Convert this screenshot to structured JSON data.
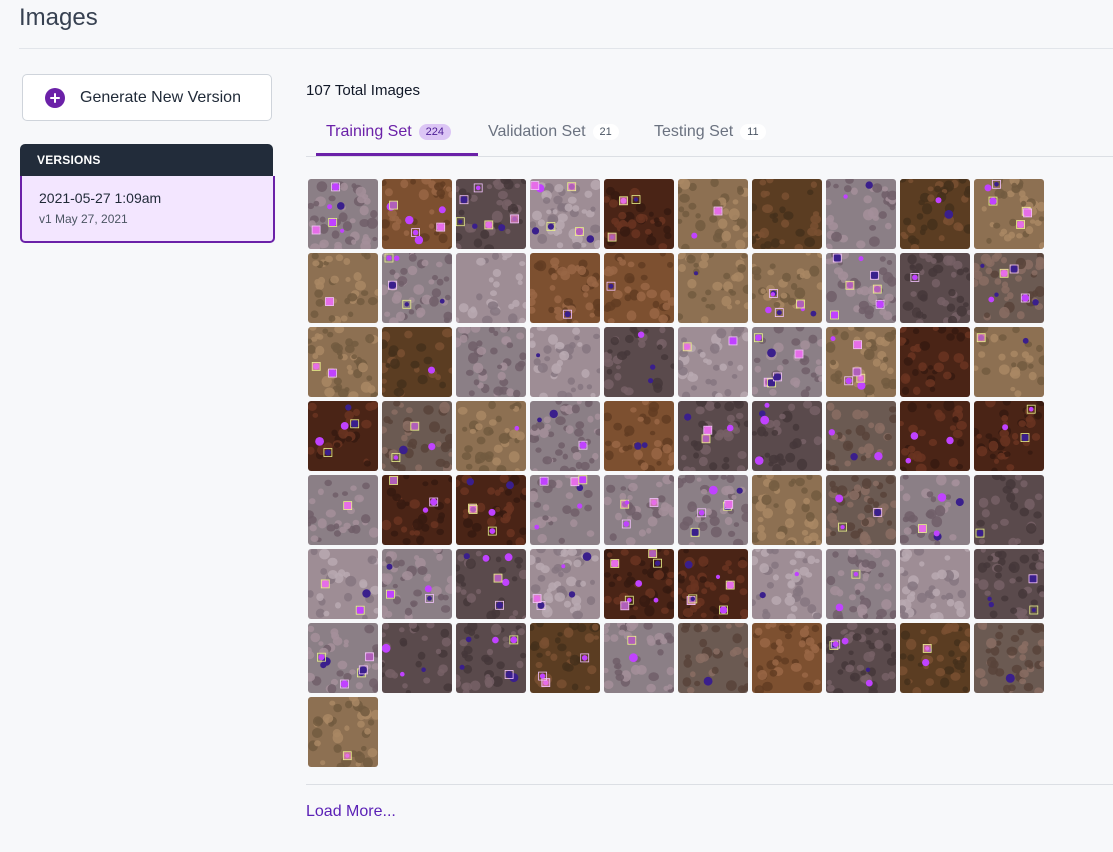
{
  "header": {
    "title": "Images"
  },
  "sidebar": {
    "generate_label": "Generate New Version",
    "versions_heading": "VERSIONS",
    "versions": [
      {
        "name": "2021-05-27 1:09am",
        "subtitle": "v1 May 27, 2021"
      }
    ]
  },
  "main": {
    "total_label": "107 Total Images",
    "tabs": [
      {
        "label": "Training Set",
        "count": "224"
      },
      {
        "label": "Validation Set",
        "count": "21"
      },
      {
        "label": "Testing Set",
        "count": "11"
      }
    ],
    "load_more_label": "Load More...",
    "thumbnail_count": 71
  },
  "colors": {
    "accent": "#6b21a8",
    "tab_badge_bg": "#dcc6f5",
    "versions_header_bg": "#222c3a",
    "selected_version_bg": "#f3e6ff",
    "cell_dark": "#3d1406",
    "cell_marker": "#c042ff",
    "box_annotation": "#ff8ad8"
  }
}
